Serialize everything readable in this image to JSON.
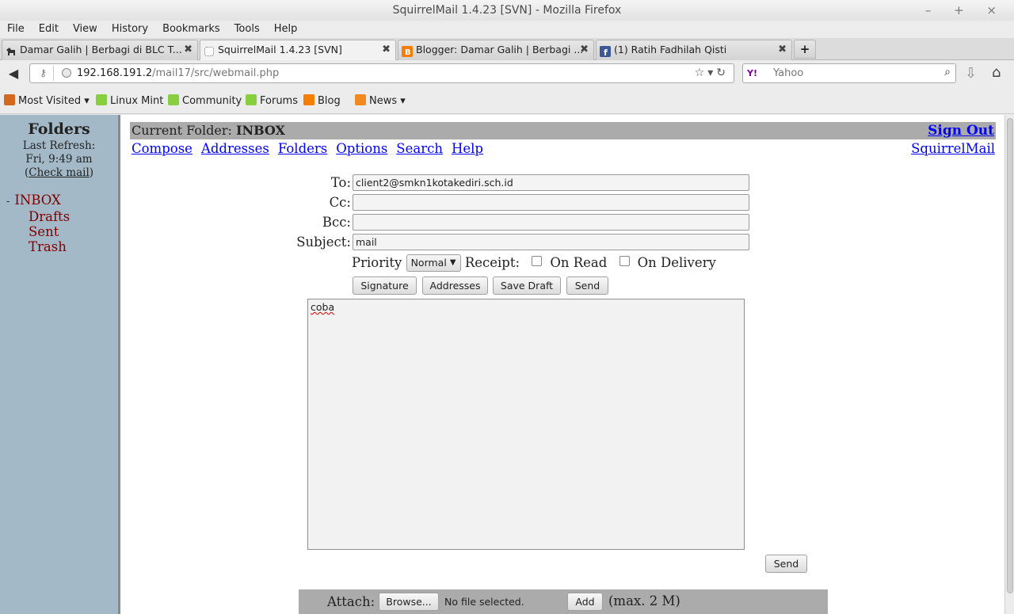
{
  "window": {
    "title": "SquirrelMail 1.4.23 [SVN] - Mozilla Firefox",
    "controls": "– + ×"
  },
  "menu": [
    "File",
    "Edit",
    "View",
    "History",
    "Bookmarks",
    "Tools",
    "Help"
  ],
  "tabs": [
    {
      "label": "Damar Galih | Berbagi di BLC T...",
      "icon_color": "#333333"
    },
    {
      "label": "SquirrelMail 1.4.23 [SVN]",
      "icon_color": "#ffffff"
    },
    {
      "label": "Blogger: Damar Galih | Berbagi ...",
      "icon_color": "#f57d00"
    },
    {
      "label": "(1) Ratih Fadhilah Qisti",
      "icon_color": "#3b5998"
    }
  ],
  "tab_close": "✖",
  "new_tab": "+",
  "url": {
    "host": "192.168.191.2",
    "path": "/mail17/src/webmail.php"
  },
  "search": {
    "engine": "Y!",
    "placeholder": "Yahoo"
  },
  "bookmarks": [
    {
      "label": "Most Visited ▾",
      "icon_color": "#d2691e"
    },
    {
      "label": "Linux Mint",
      "icon_color": "#87cf3e"
    },
    {
      "label": "Community",
      "icon_color": "#87cf3e"
    },
    {
      "label": "Forums",
      "icon_color": "#87cf3e"
    },
    {
      "label": "Blog",
      "icon_color": "#f57d00"
    },
    {
      "label": "News ▾",
      "icon_color": "#f5891f"
    }
  ],
  "sidebar": {
    "title": "Folders",
    "last_refresh_label": "Last Refresh:",
    "last_refresh_time": "Fri, 9:49 am",
    "check_mail": "Check mail",
    "folders": [
      "INBOX",
      "Drafts",
      "Sent",
      "Trash"
    ]
  },
  "header": {
    "current_folder_label": "Current Folder:",
    "current_folder": "INBOX",
    "sign_out": "Sign Out",
    "nav": [
      "Compose",
      "Addresses",
      "Folders",
      "Options",
      "Search",
      "Help"
    ],
    "brand": "SquirrelMail"
  },
  "compose": {
    "to_label": "To:",
    "to": "client2@smkn1kotakediri.sch.id",
    "cc_label": "Cc:",
    "cc": "",
    "bcc_label": "Bcc:",
    "bcc": "",
    "subject_label": "Subject:",
    "subject": "mail",
    "priority_label": "Priority",
    "priority": "Normal",
    "receipt_label": "Receipt:",
    "on_read": "On Read",
    "on_delivery": "On Delivery",
    "buttons": {
      "signature": "Signature",
      "addresses": "Addresses",
      "save_draft": "Save Draft",
      "send": "Send"
    },
    "body": "coba",
    "send_bottom": "Send"
  },
  "attach": {
    "label": "Attach:",
    "browse": "Browse...",
    "status": "No file selected.",
    "add": "Add",
    "max": "(max. 2 M)"
  }
}
